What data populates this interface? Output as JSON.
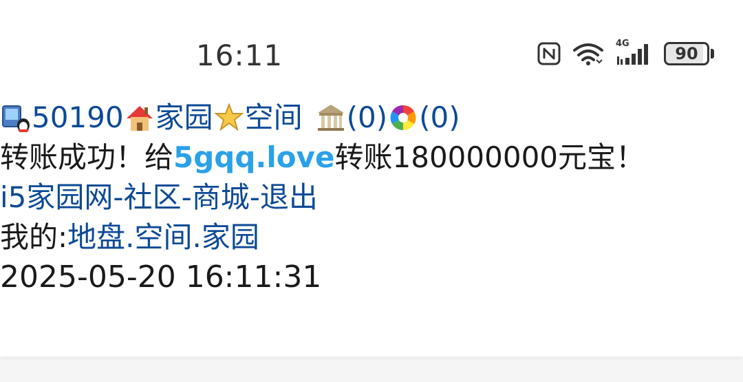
{
  "status_bar": {
    "time": "16:11",
    "network": "4G",
    "battery": "90"
  },
  "nav": {
    "user_id": "50190",
    "home_label": "家园",
    "space_label": "空间",
    "bank_count": "(0)",
    "camera_count": "(0)"
  },
  "message": {
    "prefix": "转账成功！给",
    "recipient": "5gqq.love",
    "suffix": "转账180000000元宝！"
  },
  "footer_links": {
    "site": "i5家园网",
    "community": "社区",
    "mall": "商城",
    "logout": "退出",
    "sep": "-"
  },
  "mine": {
    "label": "我的:",
    "land": "地盘",
    "space": "空间",
    "home": "家园",
    "dot": "."
  },
  "timestamp": "2025-05-20 16:11:31",
  "colors": {
    "link": "#0d4a96",
    "brand": "#2aa1e8"
  }
}
